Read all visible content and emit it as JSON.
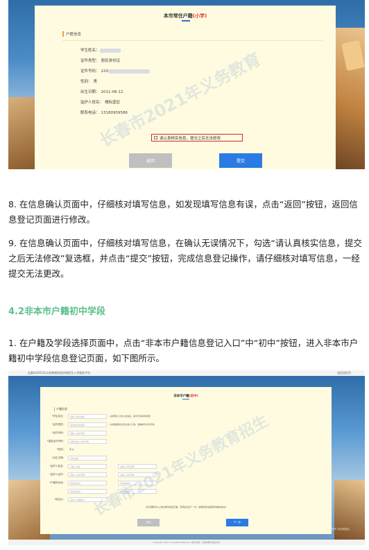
{
  "shot1": {
    "title_prefix": "本市常住户籍",
    "title_suffix": "(小学)",
    "section": "户籍信息",
    "rows": [
      {
        "label": "学生姓名：",
        "value": ""
      },
      {
        "label": "证件类型：",
        "value": "居民身份证"
      },
      {
        "label": "证件号码：",
        "value": "220"
      },
      {
        "label": "性别：",
        "value": "男"
      },
      {
        "label": "出生日期：",
        "value": "2011-06-12"
      },
      {
        "label": "监护人姓名：",
        "value": "襦标塗記"
      },
      {
        "label": "联系电话：",
        "value": "13180959586"
      }
    ],
    "confirm_text": "请认真核实信息，提交之后无法修改",
    "back_label": "返回",
    "submit_label": "提交",
    "watermark": "长春市2021年义务教育"
  },
  "article": {
    "p8": "8. 在信息确认页面中，仔细核对填写信息，如发现填写信息有误，点击“返回”按钮，返回信息登记页面进行修改。",
    "p9": "9. 在信息确认页面中，仔细核对填写信息，在确认无误情况下，勾选“请认真核实信息，提交之后无法修改”复选框，并点击“提交”按钮，完成信息登记操作，请仔细核对填写信息，一经提交无法更改。",
    "heading": "4.2非本市户籍初中学段",
    "p1": "1. 在户籍及学段选择页面中，点击“非本市户籍信息登记入口”中“初中”按钮，进入非本市户籍初中学段信息登记页面，如下图所示。"
  },
  "shot2": {
    "topbar_title": "长春市2021年义务教育阶段学校招生入学服务平台",
    "topbar_right": "【返回首页】",
    "title_prefix": "非本市户籍",
    "title_suffix": "(初中)",
    "section": "户籍信息",
    "fields": [
      {
        "label": "*学生姓名：",
        "placeholder": "请输入学生姓名",
        "note": "(请按照户口簿上的姓名，填写不能填写错误)"
      },
      {
        "label": "*证件类型：",
        "placeholder": "请选择证件类型",
        "note": "(请根据居民身份证或户口簿，准确填写证件号码)"
      },
      {
        "label": "*证件号码：",
        "placeholder": "请输入证件号码",
        "note": ""
      },
      {
        "label": "*重复证件号码：",
        "placeholder": "请再次输入证件号码",
        "note": ""
      },
      {
        "label": "*性别：",
        "placeholder": "男    女",
        "note": ""
      },
      {
        "label": "*出生日期：",
        "placeholder": "自动生成",
        "note": ""
      },
      {
        "label": "*监护人姓名：",
        "placeholder": "请输入姓名",
        "note": ""
      },
      {
        "label": "*监护人证件：",
        "placeholder": "请输入证件号码",
        "note": ""
      },
      {
        "label": "*户籍所在地：",
        "placeholder": "请选择省份",
        "note": ""
      },
      {
        "label": "",
        "placeholder": "请选择区县",
        "note": ""
      },
      {
        "label": "*现住址：",
        "placeholder": "请输入详细地址",
        "note": ""
      }
    ],
    "right_fields": [
      "请输入手机号码",
      "请输入手机号码",
      "请选择城市",
      "请选择街道"
    ],
    "note": "(请仔细核对以上信息填写是否正确，无误后点击下一步，如需修改请返回修改相关信息)",
    "back_label": "返回",
    "next_label": "下一步",
    "footer": "Copyright 2021. All Rights Reserved.  技术支持：长春市教育信息中心",
    "watermark": "长春市2021年义务教育招生",
    "corner_watermark": "知乎 @吉林招生"
  }
}
